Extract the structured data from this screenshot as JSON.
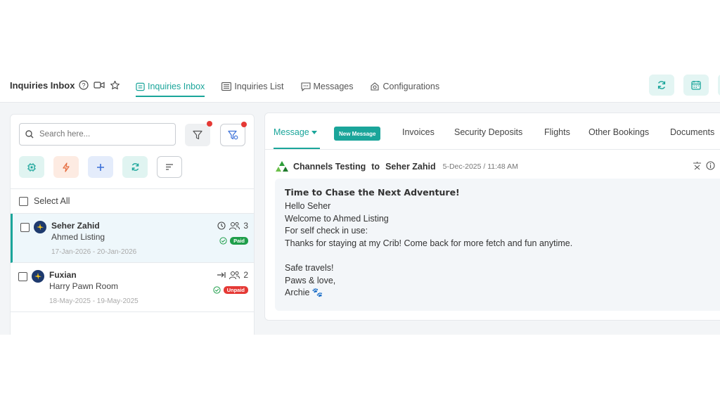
{
  "topbar": {
    "title": "Inquiries Inbox",
    "tabs": [
      {
        "label": "Inquiries Inbox",
        "icon": "inbox-icon",
        "active": true
      },
      {
        "label": "Inquiries List",
        "icon": "list-icon",
        "active": false
      },
      {
        "label": "Messages",
        "icon": "chat-icon",
        "active": false
      },
      {
        "label": "Configurations",
        "icon": "config-icon",
        "active": false
      }
    ],
    "buttons": [
      "refresh-icon",
      "calendar-icon"
    ]
  },
  "sidebar": {
    "search_placeholder": "Search here...",
    "select_all": "Select All",
    "inquiries": [
      {
        "name": "Seher Zahid",
        "listing": "Ahmed Listing",
        "dates": "17-Jan-2026 - 20-Jan-2026",
        "guests": "3",
        "status": "Paid",
        "selected": true
      },
      {
        "name": "Fuxian",
        "listing": "Harry Pawn Room",
        "dates": "18-May-2025 - 19-May-2025",
        "guests": "2",
        "status": "Unpaid",
        "selected": false
      }
    ]
  },
  "detail": {
    "tabs": {
      "message": "Message",
      "new_message": "New Message",
      "invoices": "Invoices",
      "security_deposits": "Security Deposits",
      "flights": "Flights",
      "other_bookings": "Other Bookings",
      "documents": "Documents"
    },
    "message": {
      "from": "Channels Testing",
      "to_word": "to",
      "to": "Seher Zahid",
      "timestamp": "5-Dec-2025 / 11:48 AM",
      "subject": "Time to Chase the Next Adventure!",
      "lines": [
        "Hello Seher",
        "Welcome to Ahmed Listing",
        "For self check in use:",
        "Thanks for staying at my Crib! Come back for more fetch and fun anytime."
      ],
      "signoff": [
        "Safe travels!",
        "Paws & love,",
        "Archie 🐾"
      ]
    }
  },
  "colors": {
    "accent": "#1aa59a",
    "paid": "#1e9e4a",
    "unpaid": "#e53935",
    "new_dot": "#e53935"
  }
}
